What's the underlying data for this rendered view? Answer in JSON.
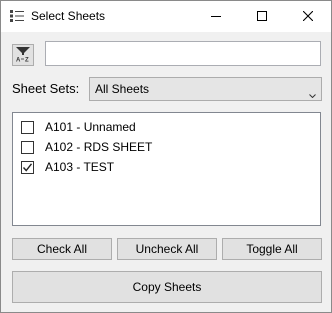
{
  "window": {
    "title": "Select Sheets"
  },
  "search": {
    "value": "",
    "placeholder": ""
  },
  "sheet_sets": {
    "label": "Sheet Sets:",
    "selected": "All Sheets"
  },
  "sheets": [
    {
      "label": "A101 - Unnamed",
      "checked": false
    },
    {
      "label": "A102 - RDS SHEET",
      "checked": false
    },
    {
      "label": "A103 - TEST",
      "checked": true
    }
  ],
  "buttons": {
    "check_all": "Check All",
    "uncheck_all": "Uncheck All",
    "toggle_all": "Toggle All",
    "copy_sheets": "Copy Sheets"
  },
  "icons": {
    "app": "list-icon",
    "filter": "sort-az-icon",
    "minimize": "minimize-icon",
    "maximize": "maximize-icon",
    "close": "close-icon",
    "dropdown": "chevron-down-icon",
    "check": "checkmark-icon"
  }
}
